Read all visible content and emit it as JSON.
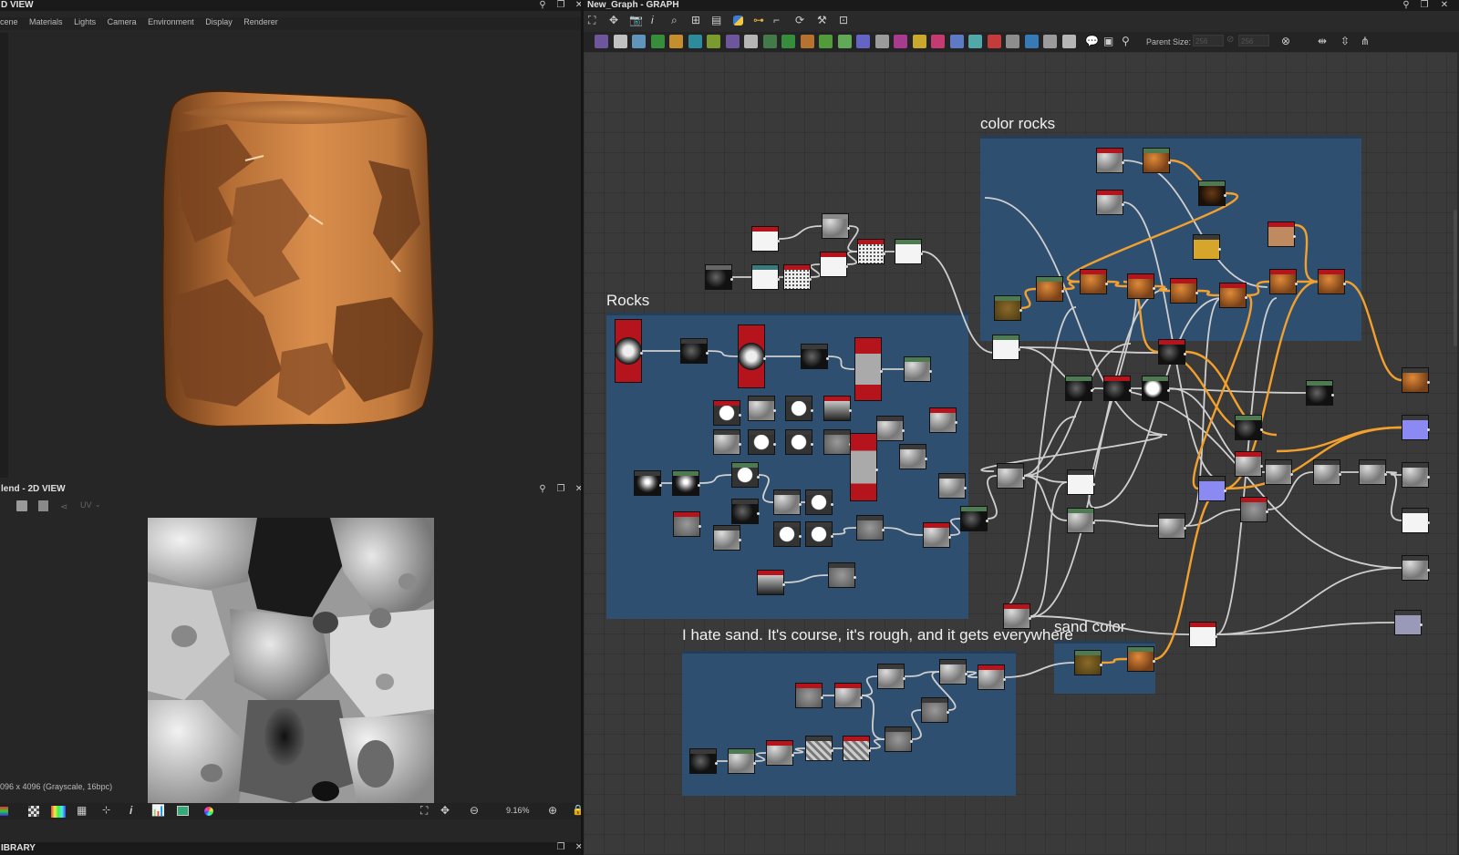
{
  "view3d": {
    "title": "D VIEW",
    "menu": [
      "cene",
      "Materials",
      "Lights",
      "Camera",
      "Environment",
      "Display",
      "Renderer"
    ]
  },
  "view2d": {
    "title": "lend - 2D VIEW",
    "uv_label": "UV",
    "image_info": "096 x 4096 (Grayscale, 16bpc)",
    "zoom": "9.16%"
  },
  "library": {
    "title": "IBRARY"
  },
  "graph": {
    "title": "New_Graph - GRAPH",
    "parent_size_label": "Parent Size:",
    "parent_size_1": "256",
    "parent_size_2": "256",
    "frames": [
      {
        "label": "color rocks"
      },
      {
        "label": "Rocks"
      },
      {
        "label": "I hate sand. It's course, it's rough, and it gets everywhere"
      },
      {
        "label": "sand color"
      }
    ]
  },
  "colors": {
    "frame_fill": "#2f4f70",
    "frame_border": "#4a6e90",
    "grid_bg": "#3a3a3a",
    "wire_white": "#cfcfcf",
    "wire_orange": "#f2a02e",
    "header_red": "#b5141c",
    "header_green": "#4e7a52"
  }
}
